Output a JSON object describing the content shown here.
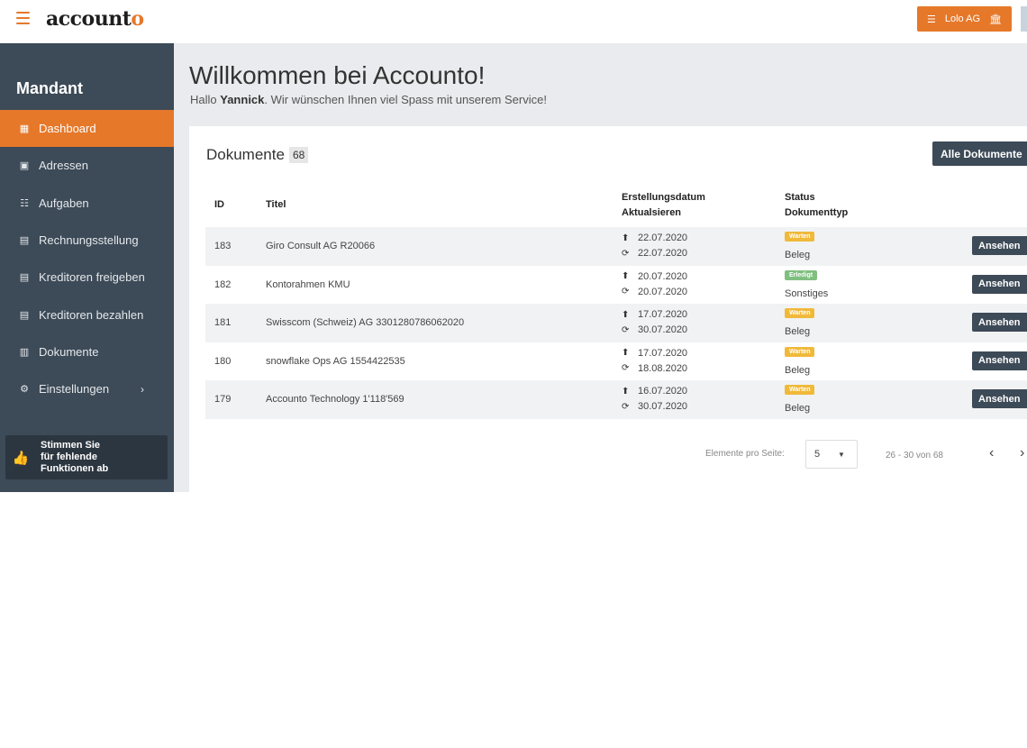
{
  "app": {
    "logo_main": "account",
    "logo_accent": "o",
    "tenant": "Lolo AG"
  },
  "sidebar": {
    "title": "Mandant",
    "items": [
      {
        "label": "Dashboard",
        "icon": "dashboard-icon",
        "active": true
      },
      {
        "label": "Adressen",
        "icon": "address-book-icon"
      },
      {
        "label": "Aufgaben",
        "icon": "task-list-icon"
      },
      {
        "label": "Rechnungsstellung",
        "icon": "invoice-icon"
      },
      {
        "label": "Kreditoren freigeben",
        "icon": "creditor-approve-icon"
      },
      {
        "label": "Kreditoren bezahlen",
        "icon": "creditor-pay-icon"
      },
      {
        "label": "Dokumente",
        "icon": "documents-icon"
      },
      {
        "label": "Einstellungen",
        "icon": "settings-icon",
        "chevron": "›"
      }
    ],
    "vote": {
      "line1": "Stimmen Sie",
      "line2": "für fehlende",
      "line3": "Funktionen ab"
    }
  },
  "main": {
    "title": "Willkommen bei Accounto!",
    "greeting_prefix": "Hallo ",
    "user": "Yannick",
    "greeting_suffix": ". Wir wünschen Ihnen viel Spass mit unserem Service!"
  },
  "documents": {
    "title": "Dokumente",
    "count": "68",
    "all_button": "Alle Dokumente",
    "headers": {
      "id": "ID",
      "title": "Titel",
      "date_line1": "Erstellungsdatum",
      "date_line2": "Aktualsieren",
      "status_line1": "Status",
      "status_line2": "Dokumenttyp"
    },
    "view_label": "Ansehen",
    "rows": [
      {
        "id": "183",
        "title": "Giro Consult AG R20066",
        "created": "22.07.2020",
        "updated": "22.07.2020",
        "status": "Warten",
        "status_color": "#f0b93a",
        "type": "Beleg"
      },
      {
        "id": "182",
        "title": "Kontorahmen KMU",
        "created": "20.07.2020",
        "updated": "20.07.2020",
        "status": "Erledigt",
        "status_color": "#7fbf7f",
        "type": "Sonstiges"
      },
      {
        "id": "181",
        "title": "Swisscom (Schweiz) AG 3301280786062020",
        "created": "17.07.2020",
        "updated": "30.07.2020",
        "status": "Warten",
        "status_color": "#f0b93a",
        "type": "Beleg"
      },
      {
        "id": "180",
        "title": "snowflake Ops AG 1554422535",
        "created": "17.07.2020",
        "updated": "18.08.2020",
        "status": "Warten",
        "status_color": "#f0b93a",
        "type": "Beleg"
      },
      {
        "id": "179",
        "title": "Accounto Technology 1'118'569",
        "created": "16.07.2020",
        "updated": "30.07.2020",
        "status": "Warten",
        "status_color": "#f0b93a",
        "type": "Beleg"
      }
    ],
    "pager": {
      "label": "Elemente pro Seite:",
      "per_page": "5",
      "range": "26 - 30 von 68"
    }
  },
  "colors": {
    "accent": "#e6782a",
    "sidebar": "#3d4a57",
    "waiting": "#f0b93a",
    "done": "#7fbf7f"
  }
}
